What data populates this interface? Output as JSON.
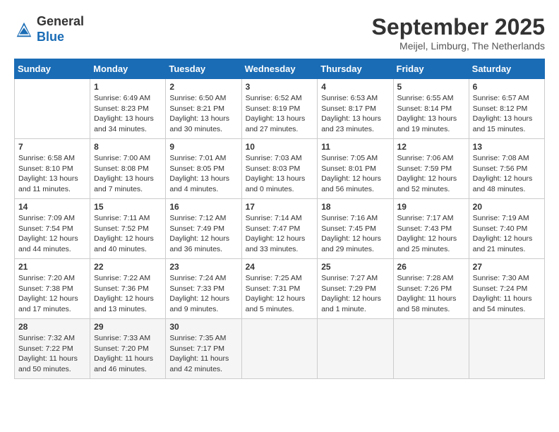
{
  "header": {
    "logo": {
      "line1": "General",
      "line2": "Blue"
    },
    "title": "September 2025",
    "subtitle": "Meijel, Limburg, The Netherlands"
  },
  "days_of_week": [
    "Sunday",
    "Monday",
    "Tuesday",
    "Wednesday",
    "Thursday",
    "Friday",
    "Saturday"
  ],
  "weeks": [
    [
      {
        "day": "",
        "info": ""
      },
      {
        "day": "1",
        "info": "Sunrise: 6:49 AM\nSunset: 8:23 PM\nDaylight: 13 hours\nand 34 minutes."
      },
      {
        "day": "2",
        "info": "Sunrise: 6:50 AM\nSunset: 8:21 PM\nDaylight: 13 hours\nand 30 minutes."
      },
      {
        "day": "3",
        "info": "Sunrise: 6:52 AM\nSunset: 8:19 PM\nDaylight: 13 hours\nand 27 minutes."
      },
      {
        "day": "4",
        "info": "Sunrise: 6:53 AM\nSunset: 8:17 PM\nDaylight: 13 hours\nand 23 minutes."
      },
      {
        "day": "5",
        "info": "Sunrise: 6:55 AM\nSunset: 8:14 PM\nDaylight: 13 hours\nand 19 minutes."
      },
      {
        "day": "6",
        "info": "Sunrise: 6:57 AM\nSunset: 8:12 PM\nDaylight: 13 hours\nand 15 minutes."
      }
    ],
    [
      {
        "day": "7",
        "info": "Sunrise: 6:58 AM\nSunset: 8:10 PM\nDaylight: 13 hours\nand 11 minutes."
      },
      {
        "day": "8",
        "info": "Sunrise: 7:00 AM\nSunset: 8:08 PM\nDaylight: 13 hours\nand 7 minutes."
      },
      {
        "day": "9",
        "info": "Sunrise: 7:01 AM\nSunset: 8:05 PM\nDaylight: 13 hours\nand 4 minutes."
      },
      {
        "day": "10",
        "info": "Sunrise: 7:03 AM\nSunset: 8:03 PM\nDaylight: 13 hours\nand 0 minutes."
      },
      {
        "day": "11",
        "info": "Sunrise: 7:05 AM\nSunset: 8:01 PM\nDaylight: 12 hours\nand 56 minutes."
      },
      {
        "day": "12",
        "info": "Sunrise: 7:06 AM\nSunset: 7:59 PM\nDaylight: 12 hours\nand 52 minutes."
      },
      {
        "day": "13",
        "info": "Sunrise: 7:08 AM\nSunset: 7:56 PM\nDaylight: 12 hours\nand 48 minutes."
      }
    ],
    [
      {
        "day": "14",
        "info": "Sunrise: 7:09 AM\nSunset: 7:54 PM\nDaylight: 12 hours\nand 44 minutes."
      },
      {
        "day": "15",
        "info": "Sunrise: 7:11 AM\nSunset: 7:52 PM\nDaylight: 12 hours\nand 40 minutes."
      },
      {
        "day": "16",
        "info": "Sunrise: 7:12 AM\nSunset: 7:49 PM\nDaylight: 12 hours\nand 36 minutes."
      },
      {
        "day": "17",
        "info": "Sunrise: 7:14 AM\nSunset: 7:47 PM\nDaylight: 12 hours\nand 33 minutes."
      },
      {
        "day": "18",
        "info": "Sunrise: 7:16 AM\nSunset: 7:45 PM\nDaylight: 12 hours\nand 29 minutes."
      },
      {
        "day": "19",
        "info": "Sunrise: 7:17 AM\nSunset: 7:43 PM\nDaylight: 12 hours\nand 25 minutes."
      },
      {
        "day": "20",
        "info": "Sunrise: 7:19 AM\nSunset: 7:40 PM\nDaylight: 12 hours\nand 21 minutes."
      }
    ],
    [
      {
        "day": "21",
        "info": "Sunrise: 7:20 AM\nSunset: 7:38 PM\nDaylight: 12 hours\nand 17 minutes."
      },
      {
        "day": "22",
        "info": "Sunrise: 7:22 AM\nSunset: 7:36 PM\nDaylight: 12 hours\nand 13 minutes."
      },
      {
        "day": "23",
        "info": "Sunrise: 7:24 AM\nSunset: 7:33 PM\nDaylight: 12 hours\nand 9 minutes."
      },
      {
        "day": "24",
        "info": "Sunrise: 7:25 AM\nSunset: 7:31 PM\nDaylight: 12 hours\nand 5 minutes."
      },
      {
        "day": "25",
        "info": "Sunrise: 7:27 AM\nSunset: 7:29 PM\nDaylight: 12 hours\nand 1 minute."
      },
      {
        "day": "26",
        "info": "Sunrise: 7:28 AM\nSunset: 7:26 PM\nDaylight: 11 hours\nand 58 minutes."
      },
      {
        "day": "27",
        "info": "Sunrise: 7:30 AM\nSunset: 7:24 PM\nDaylight: 11 hours\nand 54 minutes."
      }
    ],
    [
      {
        "day": "28",
        "info": "Sunrise: 7:32 AM\nSunset: 7:22 PM\nDaylight: 11 hours\nand 50 minutes."
      },
      {
        "day": "29",
        "info": "Sunrise: 7:33 AM\nSunset: 7:20 PM\nDaylight: 11 hours\nand 46 minutes."
      },
      {
        "day": "30",
        "info": "Sunrise: 7:35 AM\nSunset: 7:17 PM\nDaylight: 11 hours\nand 42 minutes."
      },
      {
        "day": "",
        "info": ""
      },
      {
        "day": "",
        "info": ""
      },
      {
        "day": "",
        "info": ""
      },
      {
        "day": "",
        "info": ""
      }
    ]
  ]
}
